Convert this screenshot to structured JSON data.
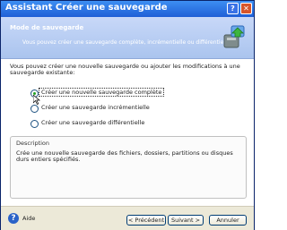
{
  "window": {
    "title": "Assistant Créer une sauvegarde",
    "help_glyph": "?",
    "close_glyph": "✕"
  },
  "header": {
    "title": "Mode de sauvegarde",
    "subtitle": "Vous pouvez créer une sauvegarde complète, incrémentielle ou différentielle.",
    "icon": "backup-wizard-icon"
  },
  "content": {
    "intro": "Vous pouvez créer une nouvelle sauvegarde ou ajouter les modifications à une sauvegarde existante:",
    "options": [
      {
        "label": "Créer une nouvelle sauvegarde complète",
        "selected": true
      },
      {
        "label": "Créer une sauvegarde incrémentielle",
        "selected": false
      },
      {
        "label": "Créer une sauvegarde différentielle",
        "selected": false
      }
    ],
    "description": {
      "title": "Description",
      "text": "Crée une nouvelle sauvegarde des fichiers, dossiers, partitions ou disques durs entiers spécifiés."
    }
  },
  "footer": {
    "help_label": "Aide",
    "help_glyph": "?",
    "prev_label": "< Précédent",
    "next_label": "Suivant >",
    "cancel_label": "Annuler"
  }
}
